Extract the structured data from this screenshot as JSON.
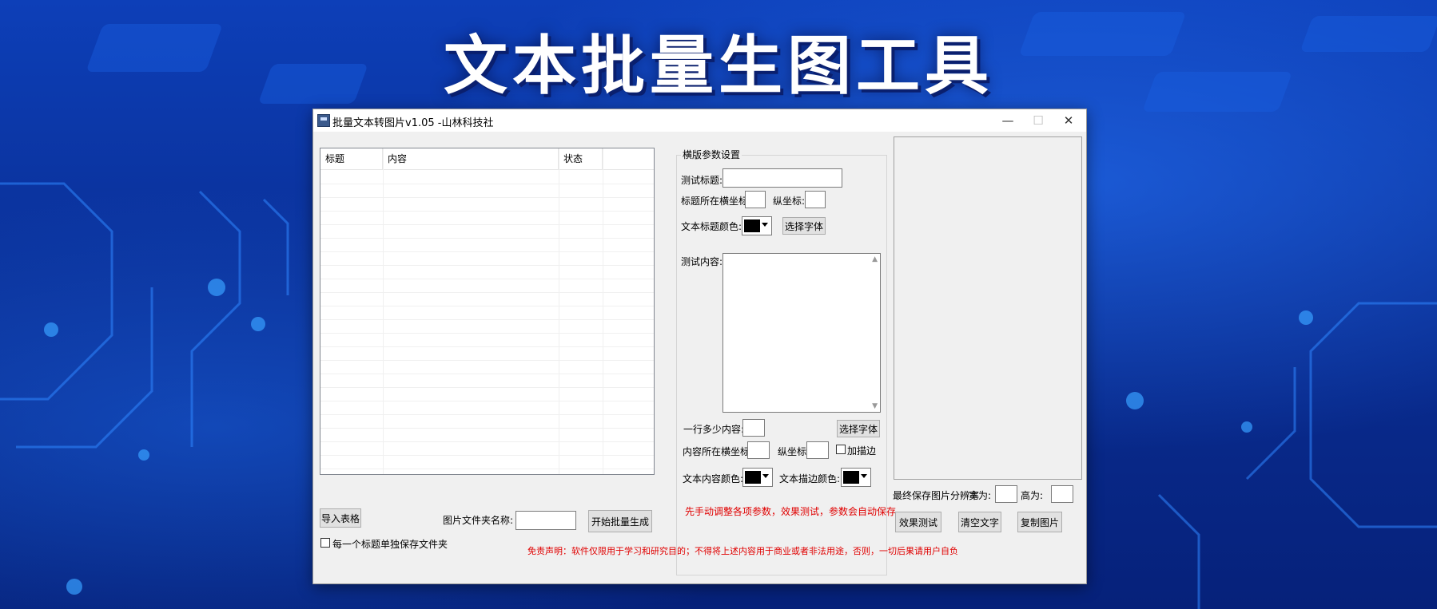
{
  "banner": {
    "title": "文本批量生图工具"
  },
  "window": {
    "title": "批量文本转图片v1.05 -山林科技社",
    "controls": {
      "minimize": "—",
      "maximize": "☐",
      "close": "✕"
    }
  },
  "table": {
    "headers": [
      "标题",
      "内容",
      "状态"
    ],
    "rows": []
  },
  "left_bottom": {
    "import_button": "导入表格",
    "folder_label": "图片文件夹名称:",
    "folder_value": "",
    "start_button": "开始批量生成",
    "per_title_checkbox": "每一个标题单独保存文件夹",
    "per_title_checked": false
  },
  "params": {
    "group_title": "横版参数设置",
    "test_title_label": "测试标题:",
    "test_title_value": "",
    "title_x_label": "标题所在横坐标:",
    "title_x_value": "",
    "title_y_label": "纵坐标:",
    "title_y_value": "",
    "title_color_label": "文本标题颜色:",
    "title_color": "#000000",
    "select_font_button_1": "选择字体",
    "test_content_label": "测试内容:",
    "test_content_value": "",
    "line_chars_label": "一行多少内容:",
    "line_chars_value": "",
    "select_font_button_2": "选择字体",
    "content_x_label": "内容所在横坐标:",
    "content_x_value": "",
    "content_y_label": "纵坐标:",
    "content_y_value": "",
    "stroke_checkbox": "加描边",
    "stroke_checked": false,
    "content_color_label": "文本内容颜色:",
    "content_color": "#000000",
    "stroke_color_label": "文本描边颜色:",
    "stroke_color": "#000000",
    "hint": "先手动调整各项参数，效果测试，参数会自动保存"
  },
  "right_panel": {
    "resolution_label": "最终保存图片分辨率",
    "width_label": "宽为:",
    "width_value": "",
    "height_label": "高为:",
    "height_value": "",
    "test_button": "效果测试",
    "clear_button": "清空文字",
    "copy_button": "复制图片"
  },
  "disclaimer": "免责声明：软件仅限用于学习和研究目的；不得将上述内容用于商业或者非法用途，否则，一切后果请用户自负",
  "colors": {
    "warning_text": "#e00000",
    "background_blue": "#0a2f96"
  }
}
